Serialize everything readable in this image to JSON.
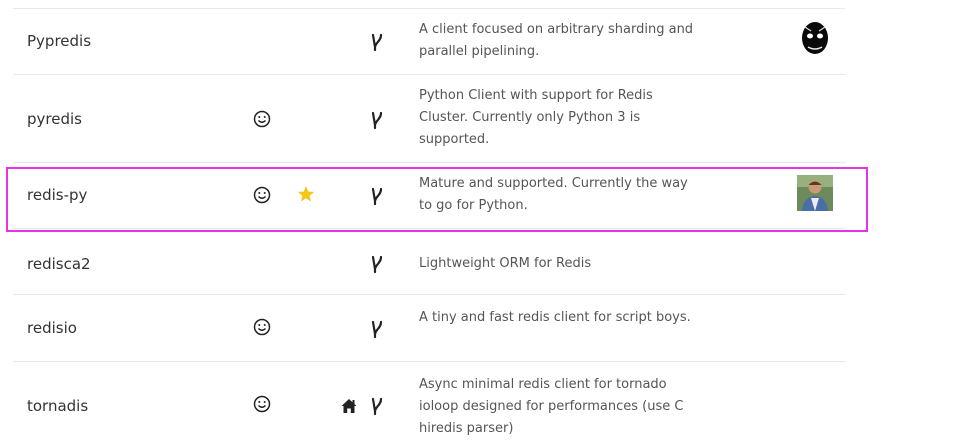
{
  "clients": [
    {
      "name": "Pypredis",
      "description": "A client focused on arbitrary sharding and parallel pipelining."
    },
    {
      "name": "pyredis",
      "description": "Python Client with support for Redis Cluster. Currently only Python 3 is supported."
    },
    {
      "name": "redis-py",
      "description": "Mature and supported. Currently the way to go for Python."
    },
    {
      "name": "redisca2",
      "description": "Lightweight ORM for Redis"
    },
    {
      "name": "redisio",
      "description": "A tiny and fast redis client for script boys."
    },
    {
      "name": "tornadis",
      "description": "Async minimal redis client for tornado ioloop designed for performances (use C hiredis parser)"
    }
  ],
  "icons": {
    "active": "smile-icon",
    "recommended": "star-icon",
    "homepage": "home-icon",
    "repository": "fork-icon"
  },
  "colors": {
    "highlight_border": "#e633e6",
    "star": "#f5c518",
    "text": "#333333"
  }
}
